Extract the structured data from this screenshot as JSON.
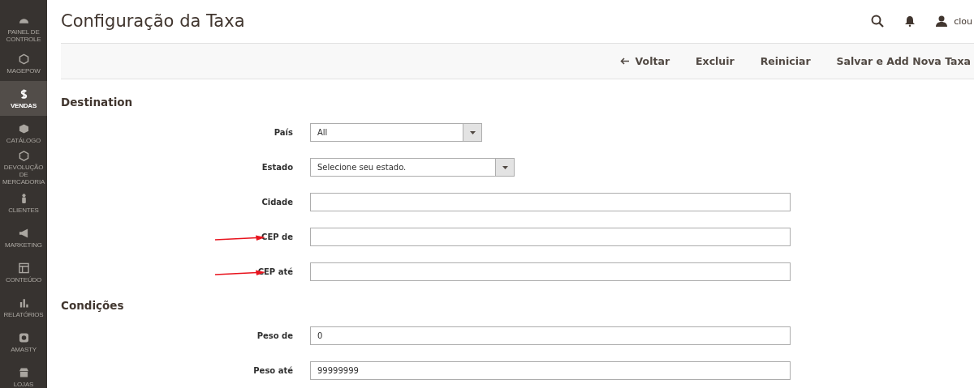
{
  "sidebar": {
    "items": [
      {
        "label": "PAINEL DE CONTROLE",
        "selected": false
      },
      {
        "label": "MAGEPOW",
        "selected": false
      },
      {
        "label": "VENDAS",
        "selected": true
      },
      {
        "label": "CATÁLOGO",
        "selected": false
      },
      {
        "label": "DEVOLUÇÃO DE MERCADORIA",
        "selected": false
      },
      {
        "label": "CLIENTES",
        "selected": false
      },
      {
        "label": "MARKETING",
        "selected": false
      },
      {
        "label": "CONTEÚDO",
        "selected": false
      },
      {
        "label": "RELATÓRIOS",
        "selected": false
      },
      {
        "label": "AMASTY",
        "selected": false
      },
      {
        "label": "LOJAS",
        "selected": false
      }
    ]
  },
  "header": {
    "title": "Configuração da Taxa",
    "user": "clou"
  },
  "actions": [
    {
      "label": "Voltar",
      "kind": "back"
    },
    {
      "label": "Excluir",
      "kind": "plain"
    },
    {
      "label": "Reiniciar",
      "kind": "plain"
    },
    {
      "label": "Salvar e Add Nova Taxa",
      "kind": "plain"
    }
  ],
  "sections": [
    {
      "title": "Destination",
      "fields": [
        {
          "label": "País",
          "kind": "select",
          "value": "All",
          "marked": false
        },
        {
          "label": "Estado",
          "kind": "select",
          "value": "Selecione seu estado.",
          "marked": false
        },
        {
          "label": "Cidade",
          "kind": "text",
          "marked": false
        },
        {
          "label": "CEP de",
          "kind": "text",
          "marked": true
        },
        {
          "label": "CEP até",
          "kind": "text",
          "marked": true
        }
      ]
    },
    {
      "title": "Condições",
      "fields": [
        {
          "label": "Peso de",
          "kind": "text",
          "value": "0",
          "marked": false
        },
        {
          "label": "Peso até",
          "kind": "text",
          "value": "99999999",
          "marked": false
        }
      ]
    }
  ]
}
